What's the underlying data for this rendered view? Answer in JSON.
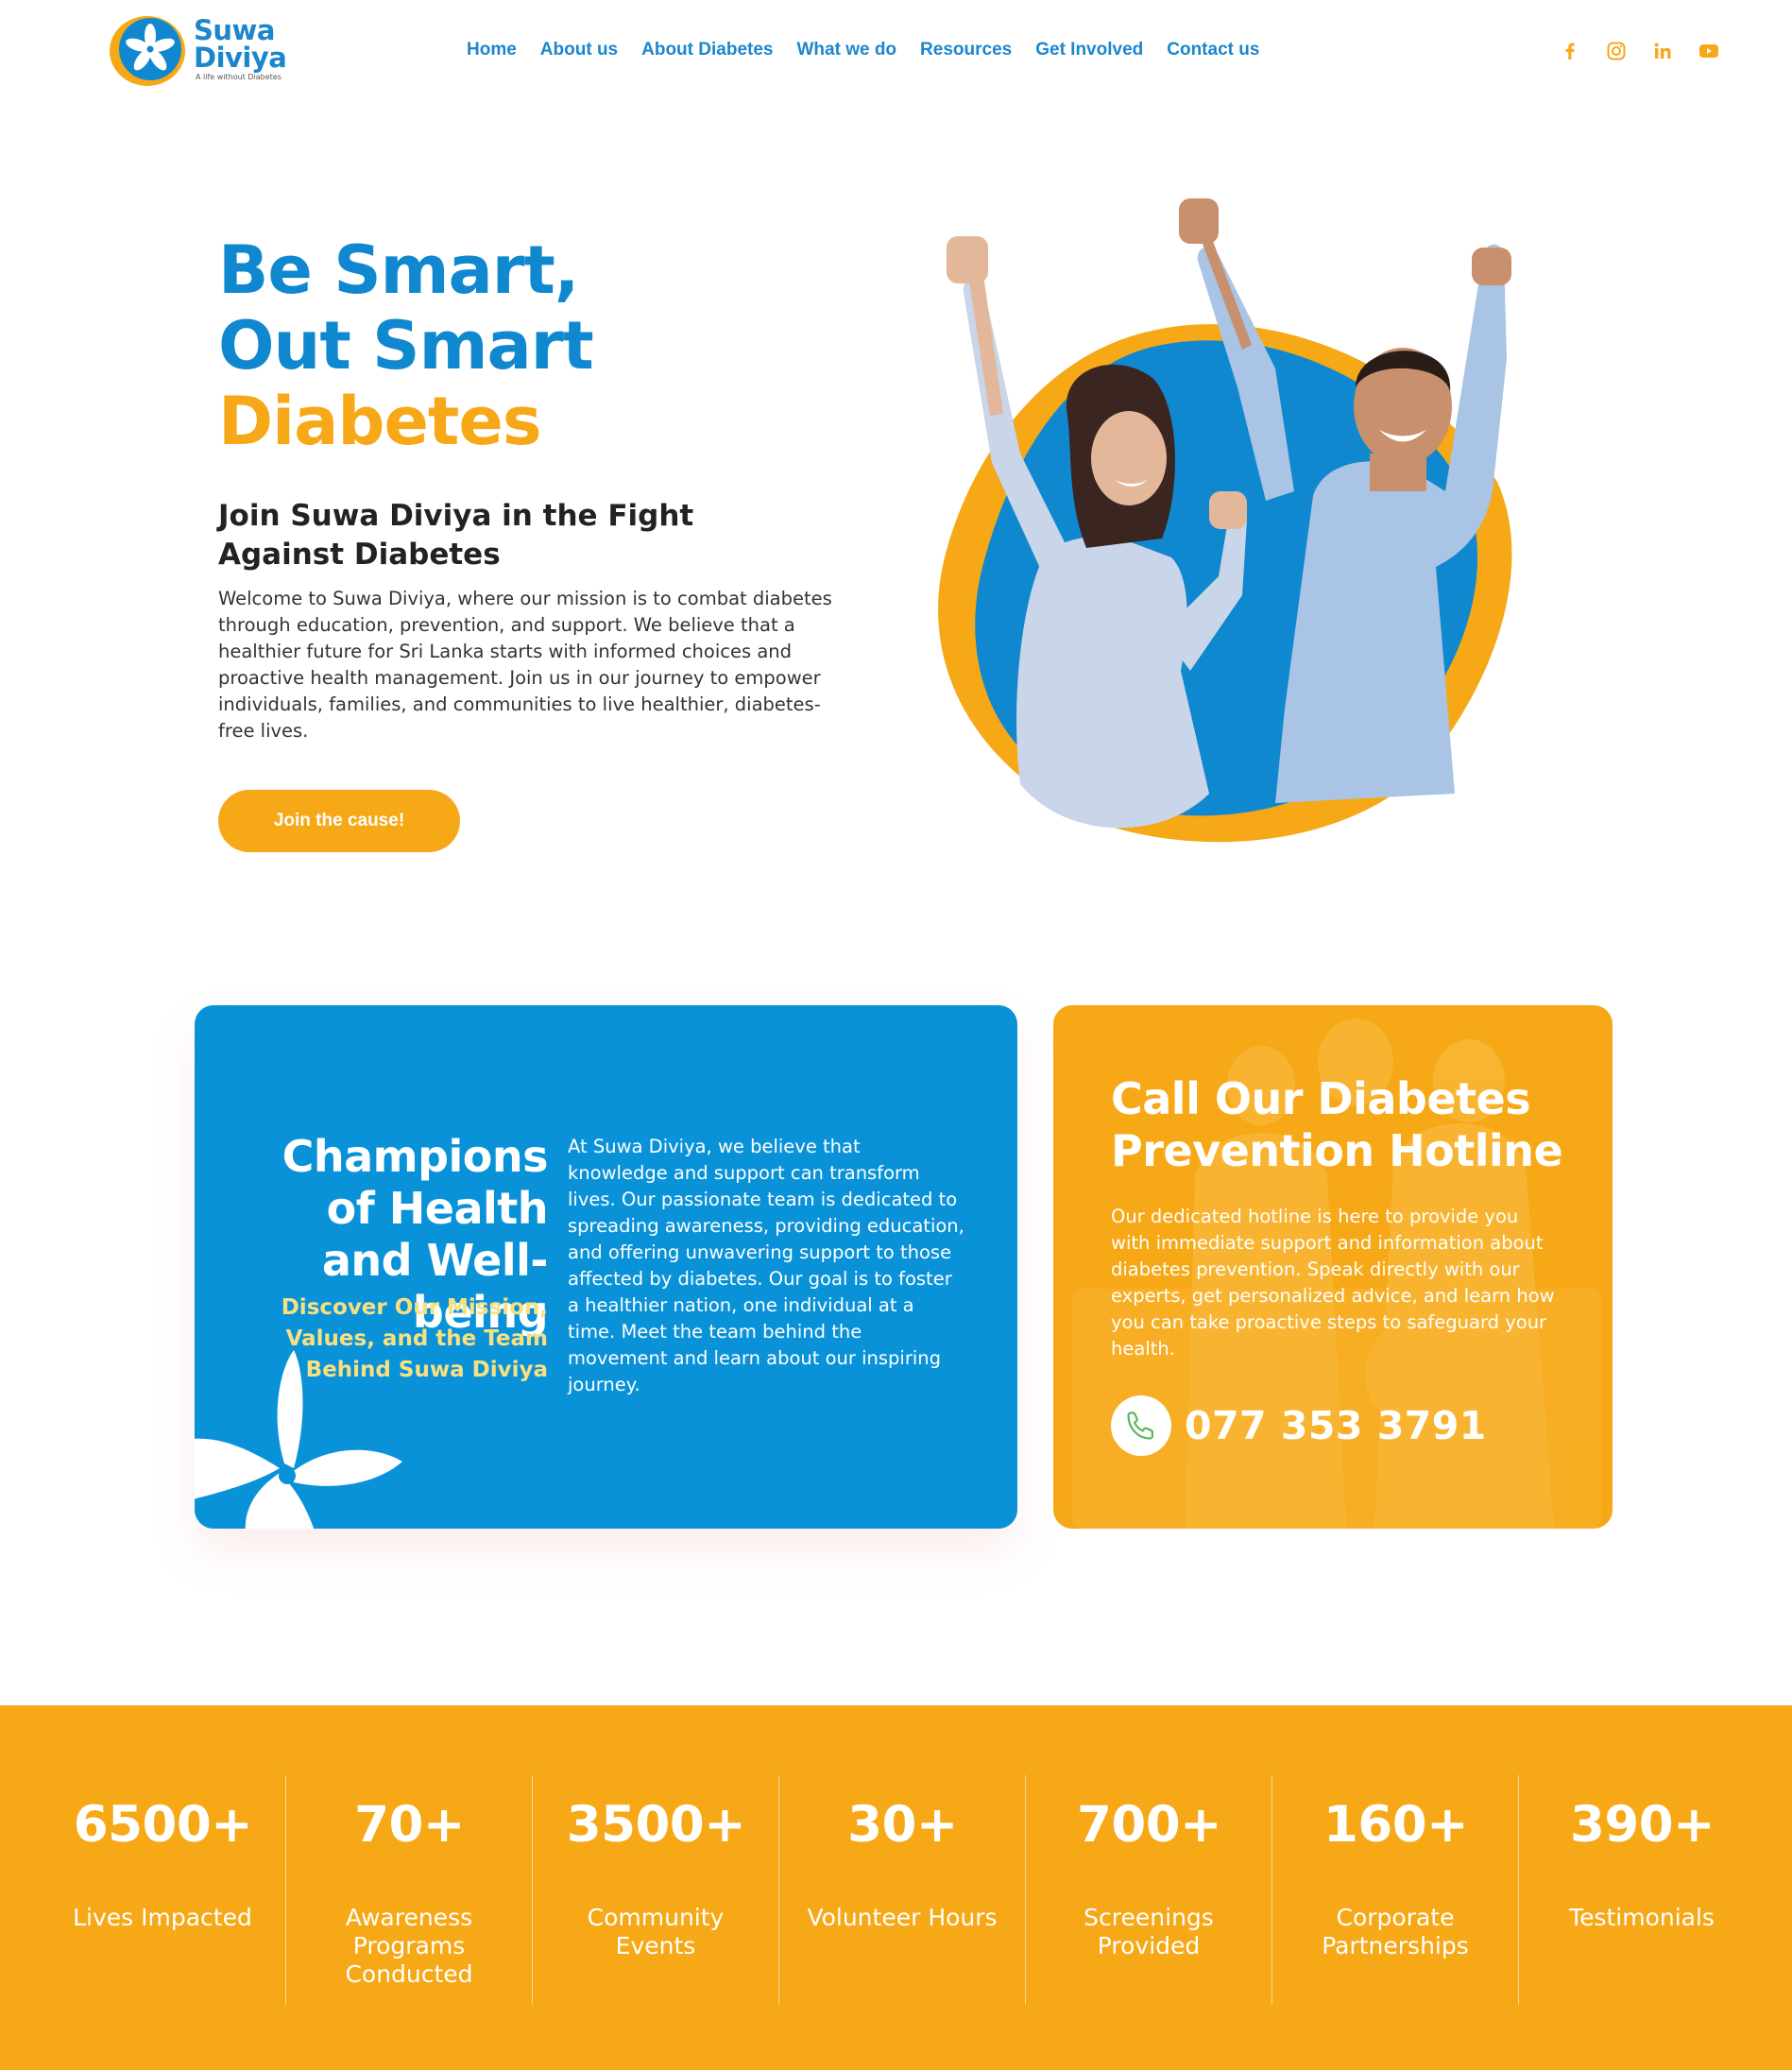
{
  "brand": {
    "name_line1": "Suwa",
    "name_line2": "Diviya",
    "tagline": "A life without Diabetes",
    "colors": {
      "blue": "#1088cf",
      "orange": "#f6a817",
      "yellow_text": "#f9e07f"
    }
  },
  "nav": {
    "items": [
      "Home",
      "About us",
      "About Diabetes",
      "What we do",
      "Resources",
      "Get Involved",
      "Contact us"
    ]
  },
  "socials": [
    "facebook-icon",
    "instagram-icon",
    "linkedin-icon",
    "youtube-icon"
  ],
  "hero": {
    "title_line1": "Be Smart,",
    "title_line2": "Out Smart",
    "title_line3": "Diabetes",
    "subtitle": "Join Suwa Diviya in the Fight Against Diabetes",
    "body": "Welcome to Suwa Diviya, where our mission is to combat diabetes through education, prevention, and support. We believe that a healthier future for Sri Lanka starts with informed choices and proactive health management. Join us in our journey to empower individuals, families, and communities to live healthier, diabetes-free lives.",
    "cta": "Join the cause!"
  },
  "champions": {
    "title": "Champions of Health and Well-being",
    "subtitle": "Discover Our Mission, Values, and the Team Behind Suwa Diviya",
    "body": "At Suwa Diviya, we believe that knowledge and support can transform lives. Our passionate team is dedicated to spreading awareness, providing education, and offering unwavering support to those affected by diabetes. Our goal is to foster a healthier nation, one individual at a time. Meet the team behind the movement and learn about our inspiring journey."
  },
  "hotline": {
    "title": "Call Our Diabetes Prevention Hotline",
    "body": "Our dedicated hotline is here to provide you with immediate support and information about diabetes prevention. Speak directly with our experts, get personalized advice, and learn how you can take proactive steps to safeguard your health.",
    "phone": "077 353 3791"
  },
  "stats": [
    {
      "value": "6500+",
      "label": "Lives Impacted"
    },
    {
      "value": "70+",
      "label": "Awareness Programs Conducted"
    },
    {
      "value": "3500+",
      "label": "Community Events"
    },
    {
      "value": "30+",
      "label": "Volunteer Hours"
    },
    {
      "value": "700+",
      "label": "Screenings Provided"
    },
    {
      "value": "160+",
      "label": "Corporate Partnerships"
    },
    {
      "value": "390+",
      "label": "Testimonials"
    }
  ]
}
